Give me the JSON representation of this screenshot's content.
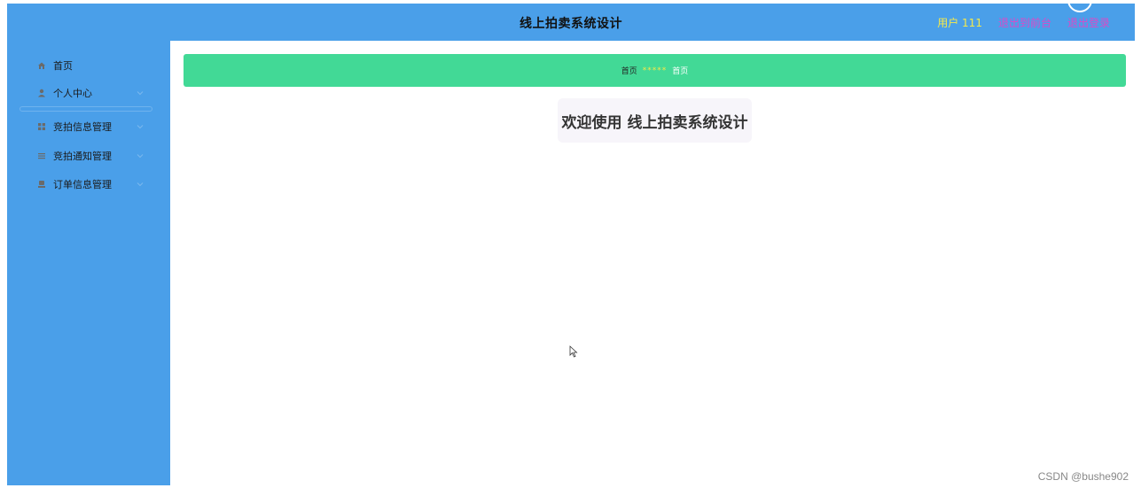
{
  "header": {
    "title": "线上拍卖系统设计",
    "user": "用户 111",
    "front_link": "退出到前台",
    "logout_link": "退出登录"
  },
  "sidebar": {
    "items": [
      {
        "label": "首页",
        "icon": "home-icon",
        "has_children": false
      },
      {
        "label": "个人中心",
        "icon": "user-icon",
        "has_children": true
      },
      {
        "label": "竞拍信息管理",
        "icon": "grid-icon",
        "has_children": true
      },
      {
        "label": "竞拍通知管理",
        "icon": "list-icon",
        "has_children": true
      },
      {
        "label": "订单信息管理",
        "icon": "order-icon",
        "has_children": true
      }
    ]
  },
  "breadcrumb": {
    "home": "首页",
    "separator": "*****",
    "current": "首页"
  },
  "main": {
    "welcome": "欢迎使用 线上拍卖系统设计"
  },
  "watermark": "CSDN @bushe902",
  "colors": {
    "header_bg": "#4a9fe9",
    "sidebar_bg": "#4a9fe9",
    "breadcrumb_bg": "#42d996",
    "user_text": "#f5e94a",
    "link_text": "#d94bc8",
    "welcome_bg": "#f7f5fa"
  }
}
